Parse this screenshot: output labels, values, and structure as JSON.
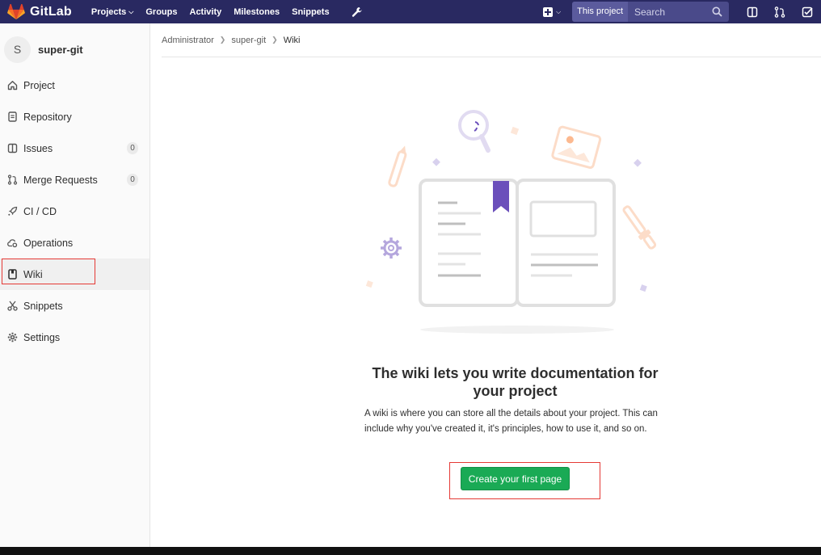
{
  "navbar": {
    "brand": "GitLab",
    "links": [
      {
        "label": "Projects",
        "has_caret": true
      },
      {
        "label": "Groups"
      },
      {
        "label": "Activity"
      },
      {
        "label": "Milestones"
      },
      {
        "label": "Snippets"
      }
    ],
    "search_scope": "This project",
    "search_placeholder": "Search"
  },
  "sidebar": {
    "avatar_letter": "S",
    "project_name": "super-git",
    "items": [
      {
        "label": "Project",
        "icon": "home-icon"
      },
      {
        "label": "Repository",
        "icon": "document-icon"
      },
      {
        "label": "Issues",
        "icon": "issues-icon",
        "count": "0"
      },
      {
        "label": "Merge Requests",
        "icon": "merge-request-icon",
        "count": "0"
      },
      {
        "label": "CI / CD",
        "icon": "rocket-icon"
      },
      {
        "label": "Operations",
        "icon": "cloud-gear-icon"
      },
      {
        "label": "Wiki",
        "icon": "book-icon",
        "active": true
      },
      {
        "label": "Snippets",
        "icon": "scissors-icon"
      },
      {
        "label": "Settings",
        "icon": "gear-icon"
      }
    ]
  },
  "breadcrumb": [
    "Administrator",
    "super-git",
    "Wiki"
  ],
  "empty_state": {
    "title": "The wiki lets you write documentation for your project",
    "text": "A wiki is where you can store all the details about your project. This can include why you've created it, it's principles, how to use it, and so on.",
    "button": "Create your first page"
  },
  "colors": {
    "navbar": "#292961",
    "primary_button": "#1aaa55",
    "highlight_box": "#e53935",
    "illustration_purple": "#6b4fbb"
  }
}
